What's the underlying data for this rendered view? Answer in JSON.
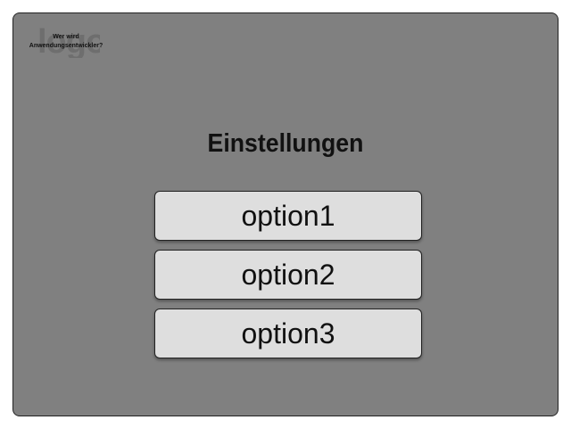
{
  "header": {
    "logo_text": "logo",
    "caption_line1": "Wer wird",
    "caption_line2": "Anwendungsentwickler?"
  },
  "main": {
    "title": "Einstellungen",
    "options": [
      {
        "label": "option1"
      },
      {
        "label": "option2"
      },
      {
        "label": "option3"
      }
    ]
  }
}
